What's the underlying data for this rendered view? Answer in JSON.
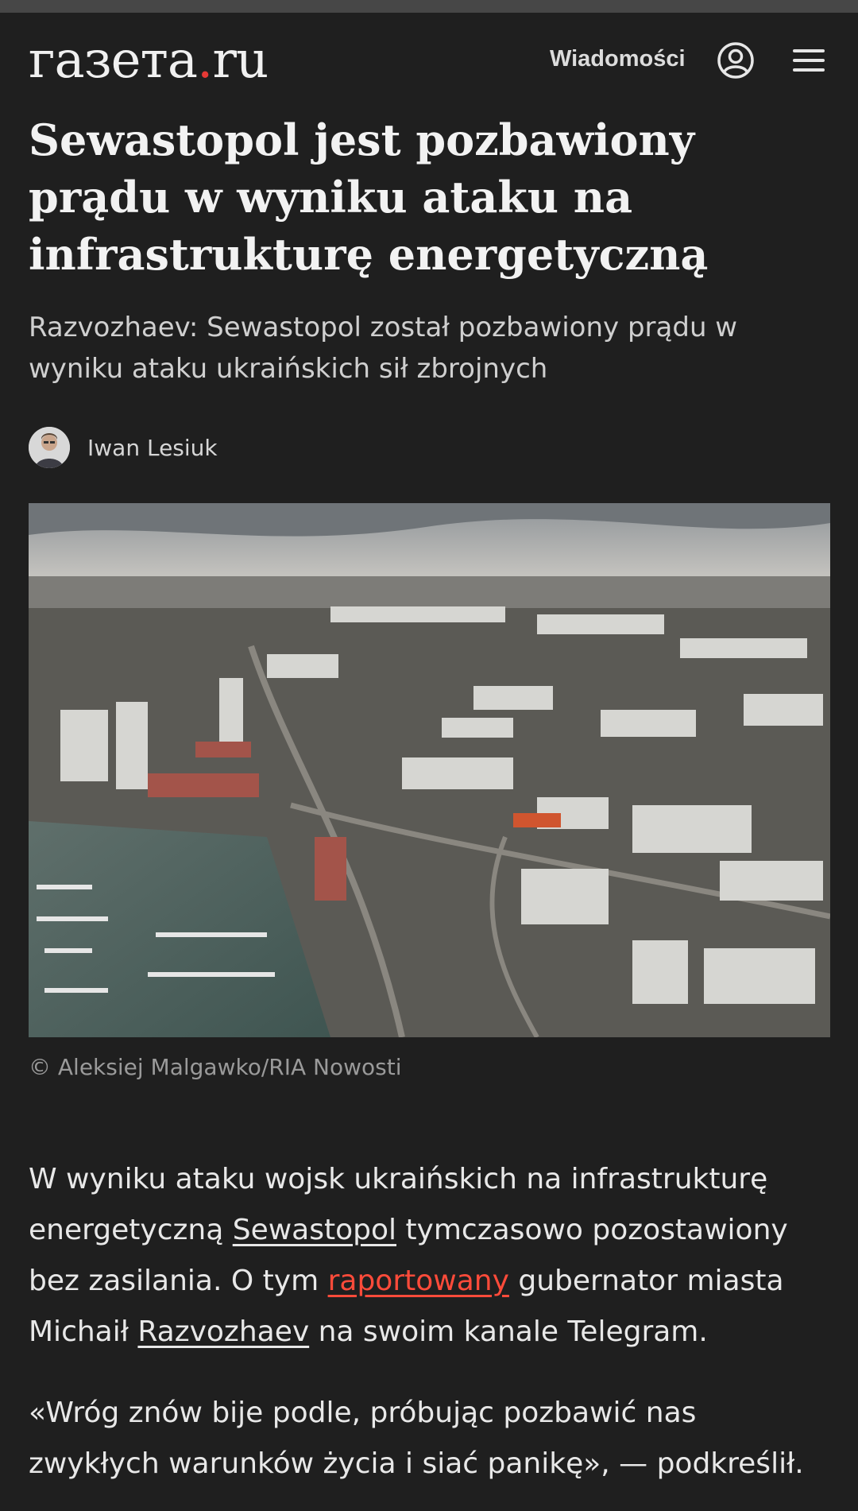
{
  "header": {
    "logo_text": "газета",
    "logo_dot": ".",
    "logo_tld": "ru",
    "nav_link": "Wiadomości",
    "icons": [
      "user-icon",
      "hamburger-menu-icon"
    ]
  },
  "article": {
    "headline": "Sewastopol jest pozbawiony prądu w wyniku ataku na infrastrukturę energetyczną",
    "subtitle": "Razvozhaev: Sewastopol został pozbawiony prądu w wyniku ataku ukraińskich sił zbrojnych",
    "author": "Iwan Lesiuk",
    "photo_caption": "© Aleksiej Malgawko/RIA Nowosti",
    "paragraph1": {
      "part1": "W wyniku ataku wojsk ukraińskich na infrastrukturę energetyczną ",
      "link1": "Sewastopol",
      "part2": " tymczasowo pozostawiony bez zasilania. O tym ",
      "link2": "raportowany",
      "part3": " gubernator miasta Michaił ",
      "link3": "Razvozhaev",
      "part4": " na swoim kanale Telegram."
    },
    "paragraph2": "«Wróg znów bije podle, próbując pozbawić nas zwykłych warunków życia i siać panikę», — podkreślił."
  },
  "colors": {
    "background": "#1f1f1f",
    "accent_red": "#e53935",
    "link_red": "#ff4b3a"
  }
}
